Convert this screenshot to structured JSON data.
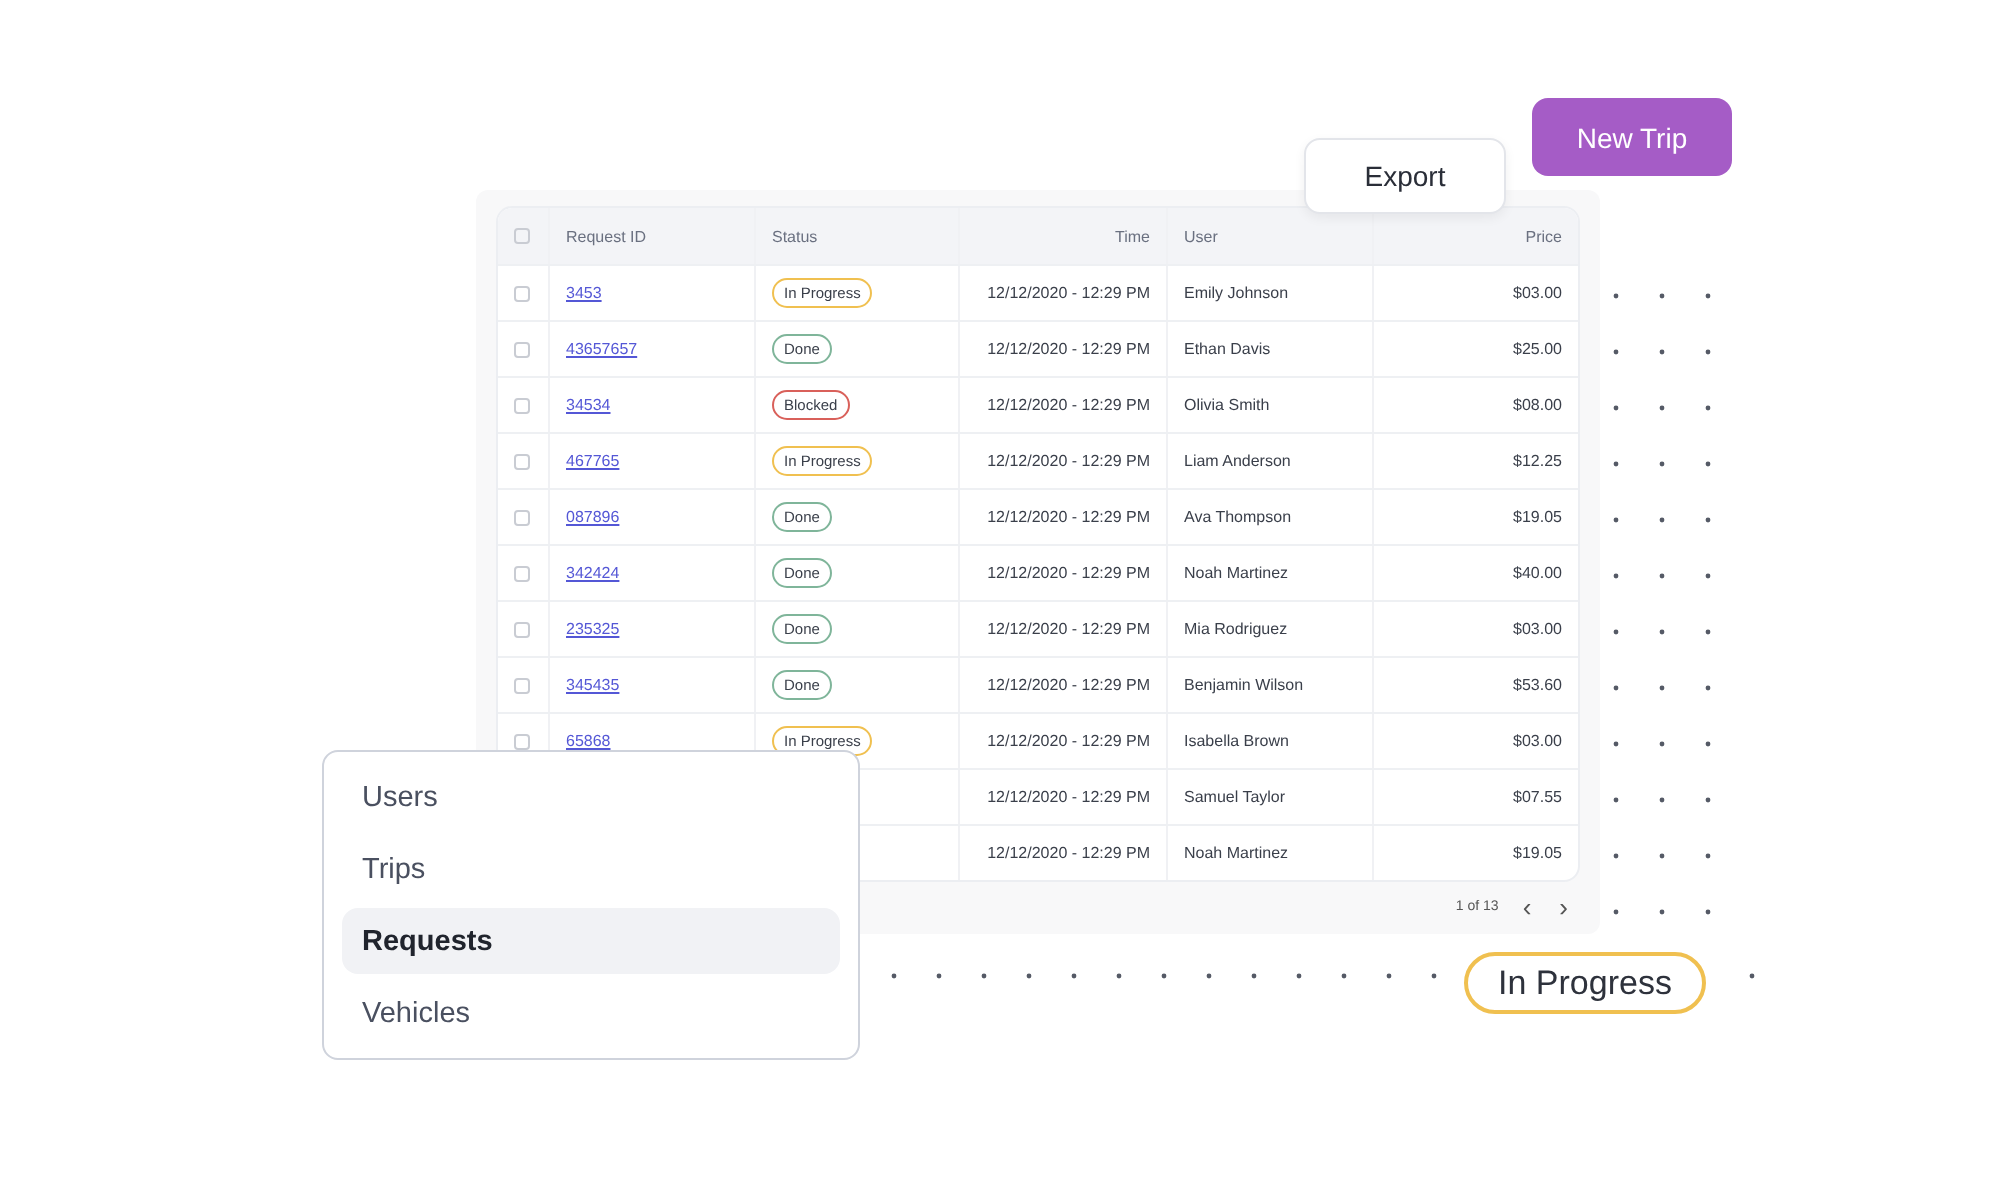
{
  "actions": [
    {
      "label": "Export",
      "kind": "secondary"
    },
    {
      "label": "New Trip",
      "kind": "primary"
    }
  ],
  "table": {
    "select_all": {
      "checked": false
    },
    "columns": [
      "Request ID",
      "Status",
      "Time",
      "User",
      "Price"
    ],
    "rows": [
      {
        "checked": false,
        "id": "3453",
        "status": {
          "label": "In Progress",
          "kind": "progress"
        },
        "time": "12/12/2020 - 12:29 PM",
        "user": "Emily Johnson",
        "price": "$03.00"
      },
      {
        "checked": false,
        "id": "43657657",
        "status": {
          "label": "Done",
          "kind": "done"
        },
        "time": "12/12/2020 - 12:29 PM",
        "user": "Ethan Davis",
        "price": "$25.00"
      },
      {
        "checked": false,
        "id": "34534",
        "status": {
          "label": "Blocked",
          "kind": "blocked"
        },
        "time": "12/12/2020 - 12:29 PM",
        "user": "Olivia Smith",
        "price": "$08.00"
      },
      {
        "checked": false,
        "id": "467765",
        "status": {
          "label": "In Progress",
          "kind": "progress"
        },
        "time": "12/12/2020 - 12:29 PM",
        "user": "Liam Anderson",
        "price": "$12.25"
      },
      {
        "checked": false,
        "id": "087896",
        "status": {
          "label": "Done",
          "kind": "done"
        },
        "time": "12/12/2020 - 12:29 PM",
        "user": "Ava Thompson",
        "price": "$19.05"
      },
      {
        "checked": false,
        "id": "342424",
        "status": {
          "label": "Done",
          "kind": "done"
        },
        "time": "12/12/2020 - 12:29 PM",
        "user": "Noah Martinez",
        "price": "$40.00"
      },
      {
        "checked": false,
        "id": "235325",
        "status": {
          "label": "Done",
          "kind": "done"
        },
        "time": "12/12/2020 - 12:29 PM",
        "user": "Mia Rodriguez",
        "price": "$03.00"
      },
      {
        "checked": false,
        "id": "345435",
        "status": {
          "label": "Done",
          "kind": "done"
        },
        "time": "12/12/2020 - 12:29 PM",
        "user": "Benjamin Wilson",
        "price": "$53.60"
      },
      {
        "checked": false,
        "id": "65868",
        "status": {
          "label": "In Progress",
          "kind": "progress"
        },
        "time": "12/12/2020 - 12:29 PM",
        "user": "Isabella Brown",
        "price": "$03.00"
      },
      {
        "time": "12/12/2020 - 12:29 PM",
        "user": "Samuel Taylor",
        "price": "$07.55"
      },
      {
        "time": "12/12/2020 - 12:29 PM",
        "user": "Noah Martinez",
        "price": "$19.05"
      }
    ],
    "pagination": {
      "page": "1 of 13",
      "prev": "‹",
      "next": "›"
    }
  },
  "menu": [
    {
      "label": "Users",
      "selected": false
    },
    {
      "label": "Trips",
      "selected": false
    },
    {
      "label": "Requests",
      "selected": true
    },
    {
      "label": "Vehicles",
      "selected": false
    }
  ],
  "status_callout": {
    "label": "In Progress",
    "kind": "progress"
  }
}
